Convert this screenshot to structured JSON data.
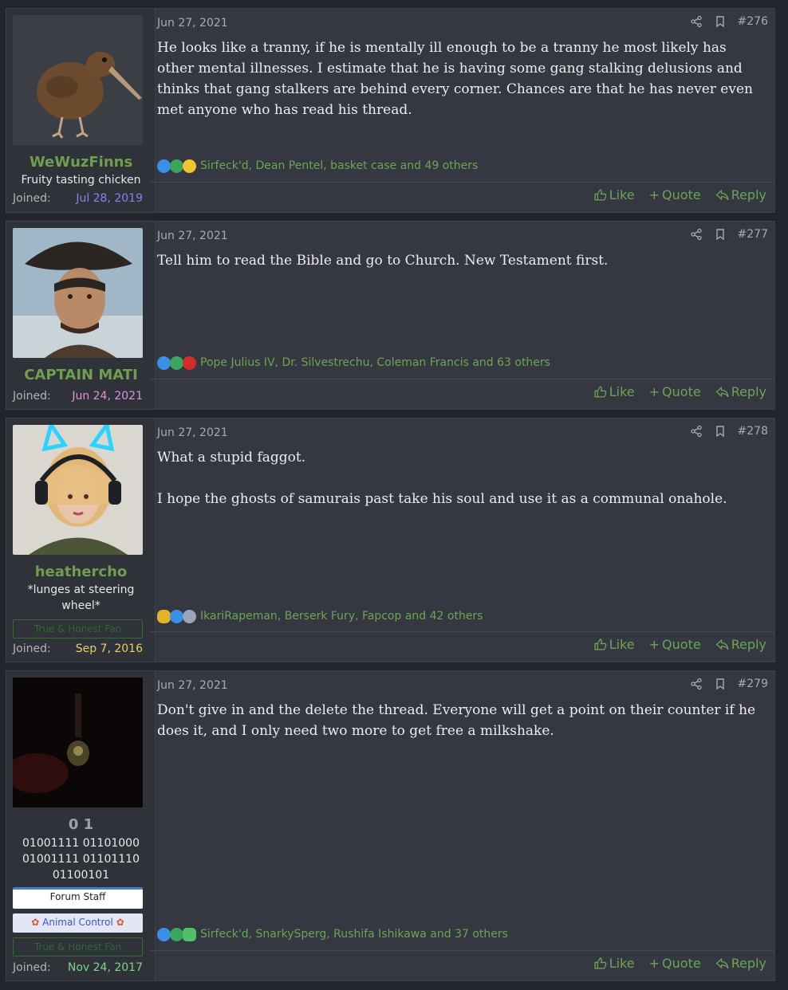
{
  "posts": [
    {
      "username": "WeWuzFinns",
      "user_title": "Fruity tasting chicken",
      "joined_label": "Joined:",
      "joined_date": "Jul 28, 2019",
      "joined_color": "#8a7ff0",
      "date": "Jun 27, 2021",
      "number": "#276",
      "paragraphs": [
        "He looks like a tranny, if he is mentally ill enough to be a tranny he most likely has other mental illnesses. I estimate that he is having some gang stalking delusions and thinks that gang stalkers are behind every corner. Chances are that he has never even met anyone who has read his thread."
      ],
      "reactions": [
        "like",
        "agree",
        "thinking"
      ],
      "reaction_text": "Sirfeck'd, Dean Pentel, basket case and 49 others",
      "avatar": "kiwi-bird"
    },
    {
      "username": "CAPTAIN MATI",
      "user_title": "",
      "joined_label": "Joined:",
      "joined_date": "Jun 24, 2021",
      "joined_color": "#e08fe0",
      "date": "Jun 27, 2021",
      "number": "#277",
      "paragraphs": [
        "Tell him to read the Bible and go to Church. New Testament first."
      ],
      "reactions": [
        "like",
        "agree",
        "heart"
      ],
      "reaction_text": "Pope Julius IV, Dr. Silvestrechu, Coleman Francis and 63 others",
      "avatar": "pirate"
    },
    {
      "username": "heathercho",
      "user_title": "*lunges at steering wheel*",
      "banner": "True & Honest Fan",
      "joined_label": "Joined:",
      "joined_date": "Sep 7, 2016",
      "joined_color": "#e6cf6a",
      "date": "Jun 27, 2021",
      "number": "#278",
      "paragraphs": [
        "What a stupid faggot.",
        "I hope the ghosts of samurais past take his soul and use it as a communal onahole."
      ],
      "reactions": [
        "pineapple",
        "like",
        "wrench"
      ],
      "reaction_text": "IkariRapeman, Berserk Fury, Fapcop and 42 others",
      "avatar": "cat-headphones"
    },
    {
      "username": "0 1",
      "user_title": "01001111 01101000 01001111 01101110 01100101",
      "staff_banner": "Forum Staff",
      "animal_banner": "Animal Control",
      "banner": "True & Honest Fan",
      "joined_label": "Joined:",
      "joined_date": "Nov 24, 2017",
      "joined_color": "#7fd48a",
      "date": "Jun 27, 2021",
      "number": "#279",
      "paragraphs": [
        "Don't give in and the delete the thread. Everyone will get a point on their counter if he does it, and I only need two more to get free a milkshake."
      ],
      "reactions": [
        "like",
        "agree",
        "cocktail"
      ],
      "reaction_text": "Sirfeck'd, SnarkySperg, Rushifa Ishikawa and 37 others",
      "avatar": "dark-room"
    }
  ],
  "labels": {
    "like": "Like",
    "quote": "Quote",
    "reply": "Reply"
  },
  "colors": {
    "link_green": "#6aa556",
    "username_green": "#6f9e4f",
    "panel": "#353840"
  }
}
